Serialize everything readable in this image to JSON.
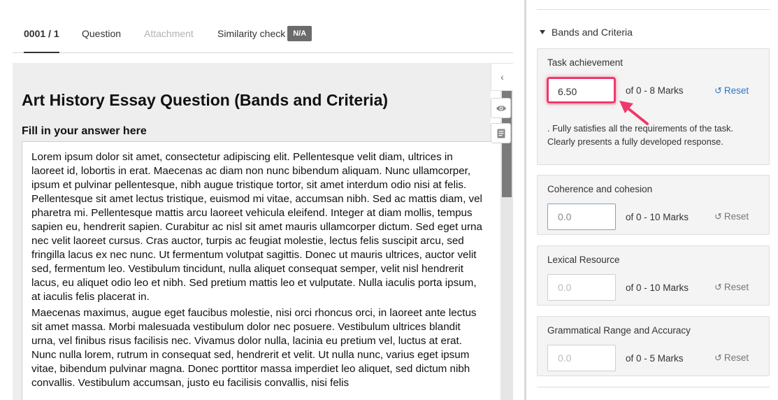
{
  "tabs": {
    "progress": "0001 / 1",
    "question": "Question",
    "attachment": "Attachment",
    "similarity": "Similarity check",
    "similarity_badge": "N/A"
  },
  "question": {
    "title": "Art History Essay Question (Bands and Criteria)",
    "prompt": "Fill in your answer here",
    "answer_paragraphs": [
      "Lorem ipsum dolor sit amet, consectetur adipiscing elit. Pellentesque velit diam, ultrices in laoreet id, lobortis in erat. Maecenas ac diam non nunc bibendum aliquam. Nunc ullamcorper, ipsum et pulvinar pellentesque, nibh augue tristique tortor, sit amet interdum odio nisi at felis. Pellentesque sit amet lectus tristique, euismod mi vitae, accumsan nibh. Sed ac mattis diam, vel pharetra mi. Pellentesque mattis arcu laoreet vehicula eleifend. Integer at diam mollis, tempus sapien eu, hendrerit sapien. Curabitur ac nisl sit amet mauris ullamcorper dictum. Sed eget urna nec velit laoreet cursus. Cras auctor, turpis ac feugiat molestie, lectus felis suscipit arcu, sed fringilla lacus ex nec nunc. Ut fermentum volutpat sagittis. Donec ut mauris ultrices, auctor velit sed, fermentum leo. Vestibulum tincidunt, nulla aliquet consequat semper, velit nisl hendrerit lacus, eu aliquet odio leo et nibh. Sed pretium mattis leo et vulputate. Nulla iaculis porta ipsum, at iaculis felis placerat in.",
      "Maecenas maximus, augue eget faucibus molestie, nisi orci rhoncus orci, in laoreet ante lectus sit amet massa. Morbi malesuada vestibulum dolor nec posuere. Vestibulum ultrices blandit urna, vel finibus risus facilisis nec. Vivamus dolor nulla, lacinia eu pretium vel, luctus at erat. Nunc nulla lorem, rutrum in consequat sed, hendrerit et velit. Ut nulla nunc, varius eget ipsum vitae, bibendum pulvinar magna. Donec porttitor massa imperdiet leo aliquet, sed dictum nibh convallis. Vestibulum accumsan, justo eu facilisis convallis, nisi felis"
    ]
  },
  "side_controls": {
    "collapse_icon": "chevron-left-icon",
    "preview_icon": "eye-icon",
    "notes_icon": "notes-icon"
  },
  "grading": {
    "section_title": "Bands and Criteria",
    "criteria": [
      {
        "label": "Task achievement",
        "value": "6.50",
        "marks": "of 0 - 8 Marks",
        "reset": "Reset",
        "description": ".  Fully satisfies all the requirements of the task. Clearly presents a fully developed response."
      },
      {
        "label": "Coherence and cohesion",
        "placeholder": "0.0",
        "marks": "of 0 - 10 Marks",
        "reset": "Reset"
      },
      {
        "label": "Lexical Resource",
        "placeholder": "0.0",
        "marks": "of 0 - 10 Marks",
        "reset": "Reset"
      },
      {
        "label": "Grammatical Range and Accuracy",
        "placeholder": "0.0",
        "marks": "of 0 - 5 Marks",
        "reset": "Reset"
      }
    ]
  },
  "colors": {
    "highlight": "#f0386b",
    "link": "#2878c8",
    "badge": "#6b6b6b"
  }
}
